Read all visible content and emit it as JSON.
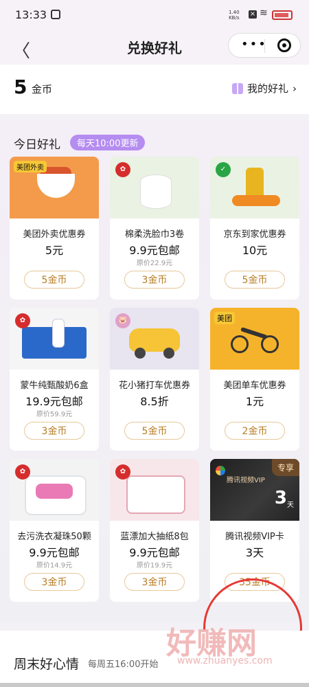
{
  "status": {
    "time": "13:33",
    "net_speed_top": "1.40",
    "net_speed_bottom": "KB/s",
    "x_label": "×"
  },
  "header": {
    "title": "兑换好礼",
    "back_glyph": "〈",
    "more_glyph": "•••"
  },
  "coins": {
    "amount": "5",
    "unit": "金币",
    "my_gifts_label": "我的好礼",
    "chevron": "›"
  },
  "today": {
    "title": "今日好礼",
    "badge": "每天10:00更新"
  },
  "cards": [
    {
      "name": "美团外卖优惠券",
      "price": "5元",
      "orig": "",
      "btn": "5金币",
      "tag": "美团外卖"
    },
    {
      "name": "棉柔洗脸巾3卷",
      "price": "9.9元包邮",
      "orig": "原价22.9元",
      "btn": "3金币",
      "tag": ""
    },
    {
      "name": "京东到家优惠券",
      "price": "10元",
      "orig": "",
      "btn": "5金币",
      "tag": ""
    },
    {
      "name": "蒙牛纯甄酸奶6盒",
      "price": "19.9元包邮",
      "orig": "原价59.9元",
      "btn": "3金币",
      "tag": ""
    },
    {
      "name": "花小猪打车优惠券",
      "price": "8.5折",
      "orig": "",
      "btn": "5金币",
      "tag": ""
    },
    {
      "name": "美团单车优惠券",
      "price": "1元",
      "orig": "",
      "btn": "2金币",
      "tag": "美团"
    },
    {
      "name": "去污洗衣凝珠50颗",
      "price": "9.9元包邮",
      "orig": "原价14.9元",
      "btn": "3金币",
      "tag": ""
    },
    {
      "name": "蓝漂加大抽纸8包",
      "price": "9.9元包邮",
      "orig": "原价19.9元",
      "btn": "3金币",
      "tag": ""
    },
    {
      "name": "腾讯视频VIP卡",
      "price": "3天",
      "orig": "",
      "btn": "35金币",
      "tag": "专享"
    }
  ],
  "vip_image": {
    "brand": "腾讯视频VIP",
    "days": "3",
    "day_unit": "天"
  },
  "weekend": {
    "title": "周末好心情",
    "subtitle": "每周五16:00开始"
  },
  "watermark": {
    "text": "好赚网",
    "url": "www.zhuanyes.com"
  }
}
